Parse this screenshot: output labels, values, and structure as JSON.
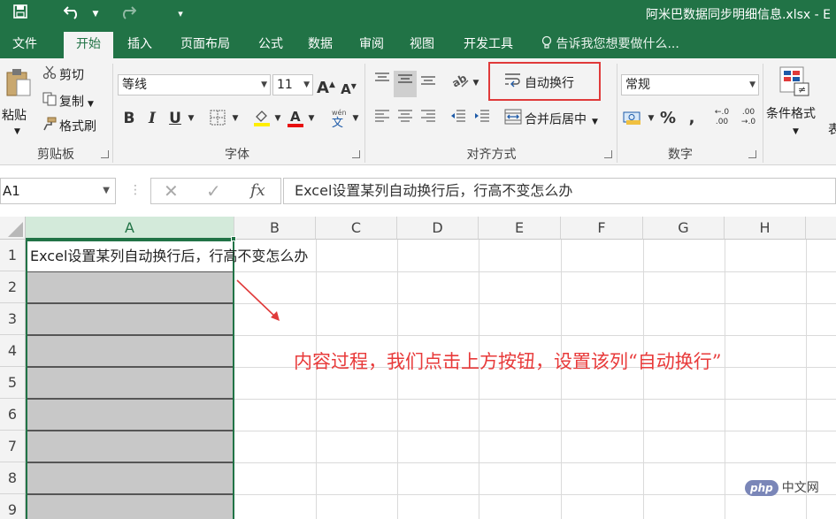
{
  "window": {
    "title": "阿米巴数据同步明细信息.xlsx - E",
    "accent_color": "#217346"
  },
  "quick_access": {
    "save_icon": "save-icon",
    "undo_icon": "undo-icon",
    "redo_icon": "redo-icon",
    "customize_icon": "customize-qat-icon"
  },
  "tabs": [
    {
      "label": "文件"
    },
    {
      "label": "开始",
      "active": true
    },
    {
      "label": "插入"
    },
    {
      "label": "页面布局"
    },
    {
      "label": "公式"
    },
    {
      "label": "数据"
    },
    {
      "label": "审阅"
    },
    {
      "label": "视图"
    },
    {
      "label": "开发工具"
    }
  ],
  "tell_me": {
    "placeholder": "告诉我您想要做什么..."
  },
  "ribbon": {
    "clipboard": {
      "label": "剪贴板",
      "paste": "粘贴",
      "cut": "剪切",
      "copy": "复制",
      "format_painter": "格式刷"
    },
    "font": {
      "label": "字体",
      "font_name": "等线",
      "font_size": "11",
      "bold": "B",
      "italic": "I",
      "underline": "U"
    },
    "alignment": {
      "label": "对齐方式",
      "wrap_text": "自动换行",
      "merge_center": "合并后居中"
    },
    "number": {
      "label": "数字",
      "format": "常规"
    },
    "styles": {
      "conditional_format": "条件格式",
      "table_partial": "表"
    }
  },
  "formula_bar": {
    "name_box": "A1",
    "fx_label": "fx",
    "content": "Excel设置某列自动换行后，行高不变怎么办"
  },
  "sheet": {
    "columns": [
      "A",
      "B",
      "C",
      "D",
      "E",
      "F",
      "G",
      "H"
    ],
    "selected_column": "A",
    "rows": [
      "1",
      "2",
      "3",
      "4",
      "5",
      "6",
      "7",
      "8",
      "9"
    ],
    "cell_a1": "Excel设置某列自动换行后，行高不变怎么办"
  },
  "annotation": {
    "text": "内容过程，我们点击上方按钮，设置该列“自动换行”",
    "color": "#e83a3a"
  },
  "watermark": {
    "badge": "php",
    "text": "中文网"
  }
}
